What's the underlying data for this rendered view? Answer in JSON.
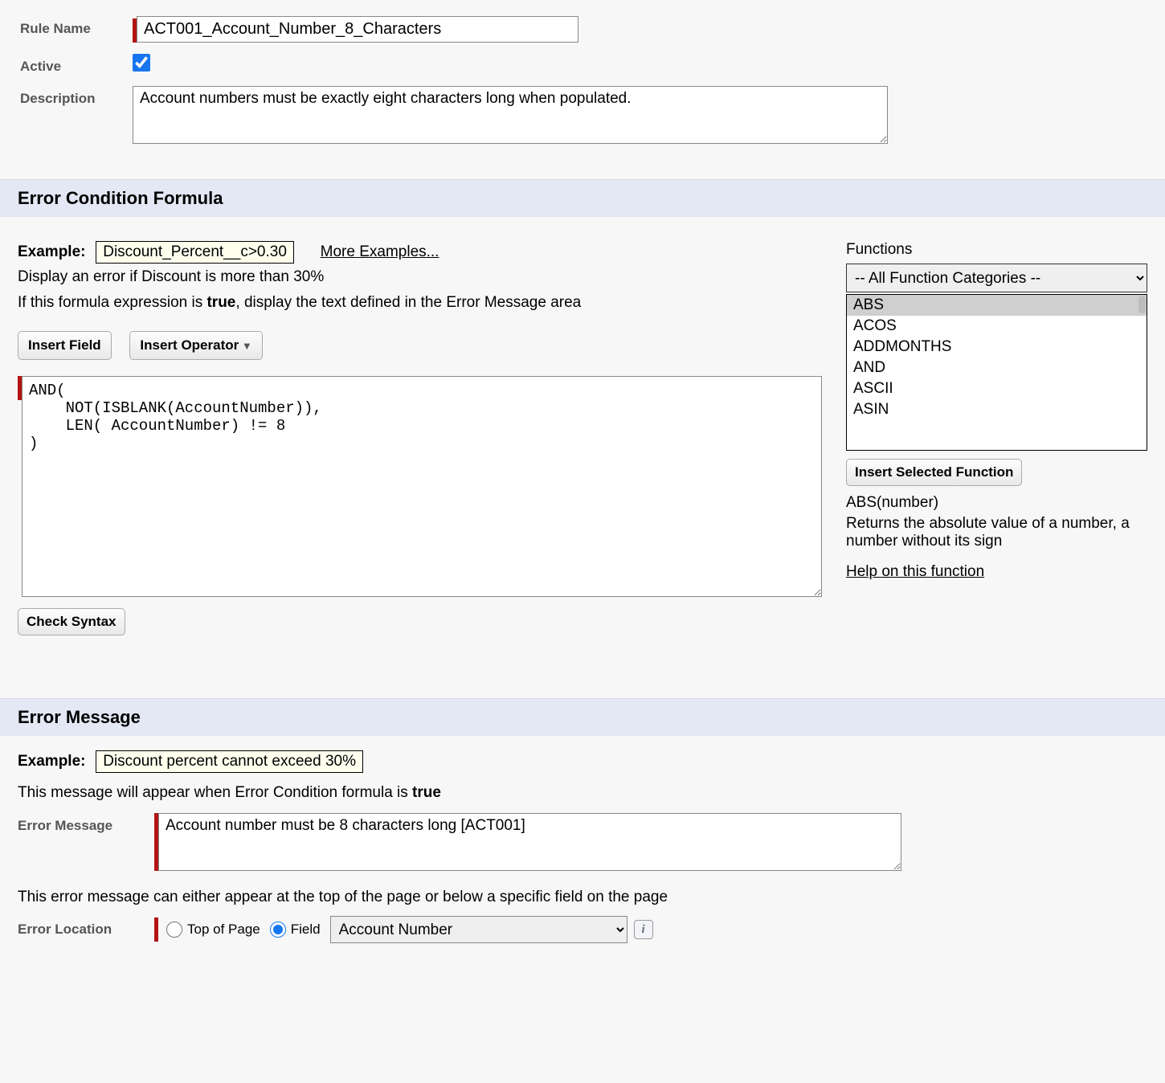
{
  "header": {
    "rule_name_label": "Rule Name",
    "rule_name_value": "ACT001_Account_Number_8_Characters",
    "active_label": "Active",
    "active_checked": true,
    "description_label": "Description",
    "description_value": "Account numbers must be exactly eight characters long when populated."
  },
  "formula_section": {
    "title": "Error Condition Formula",
    "example_label": "Example:",
    "example_text": "Discount_Percent__c>0.30",
    "more_examples": "More Examples...",
    "example_hint": "Display an error if Discount is more than 30%",
    "cond_text_1": "If this formula expression is ",
    "cond_text_bold": "true",
    "cond_text_2": ", display the text defined in the Error Message area",
    "insert_field": "Insert Field",
    "insert_operator": "Insert Operator",
    "formula": "AND(\n    NOT(ISBLANK(AccountNumber)),\n    LEN( AccountNumber) != 8\n)",
    "check_syntax": "Check Syntax",
    "functions_label": "Functions",
    "category_selected": "-- All Function Categories --",
    "functions": [
      "ABS",
      "ACOS",
      "ADDMONTHS",
      "AND",
      "ASCII",
      "ASIN"
    ],
    "selected_function_index": 0,
    "insert_selected": "Insert Selected Function",
    "func_signature": "ABS(number)",
    "func_description": "Returns the absolute value of a number, a number without its sign",
    "help_link": "Help on this function"
  },
  "error_message_section": {
    "title": "Error Message",
    "example_label": "Example:",
    "example_text": "Discount percent cannot exceed 30%",
    "hint_1": "This message will appear when Error Condition formula is ",
    "hint_bold": "true",
    "error_message_label": "Error Message",
    "error_message_value": "Account number must be 8 characters long [ACT001]",
    "loc_hint": "This error message can either appear at the top of the page or below a specific field on the page",
    "error_location_label": "Error Location",
    "top_of_page": "Top of Page",
    "field_label": "Field",
    "field_selected": "Account Number",
    "location_choice": "field"
  }
}
